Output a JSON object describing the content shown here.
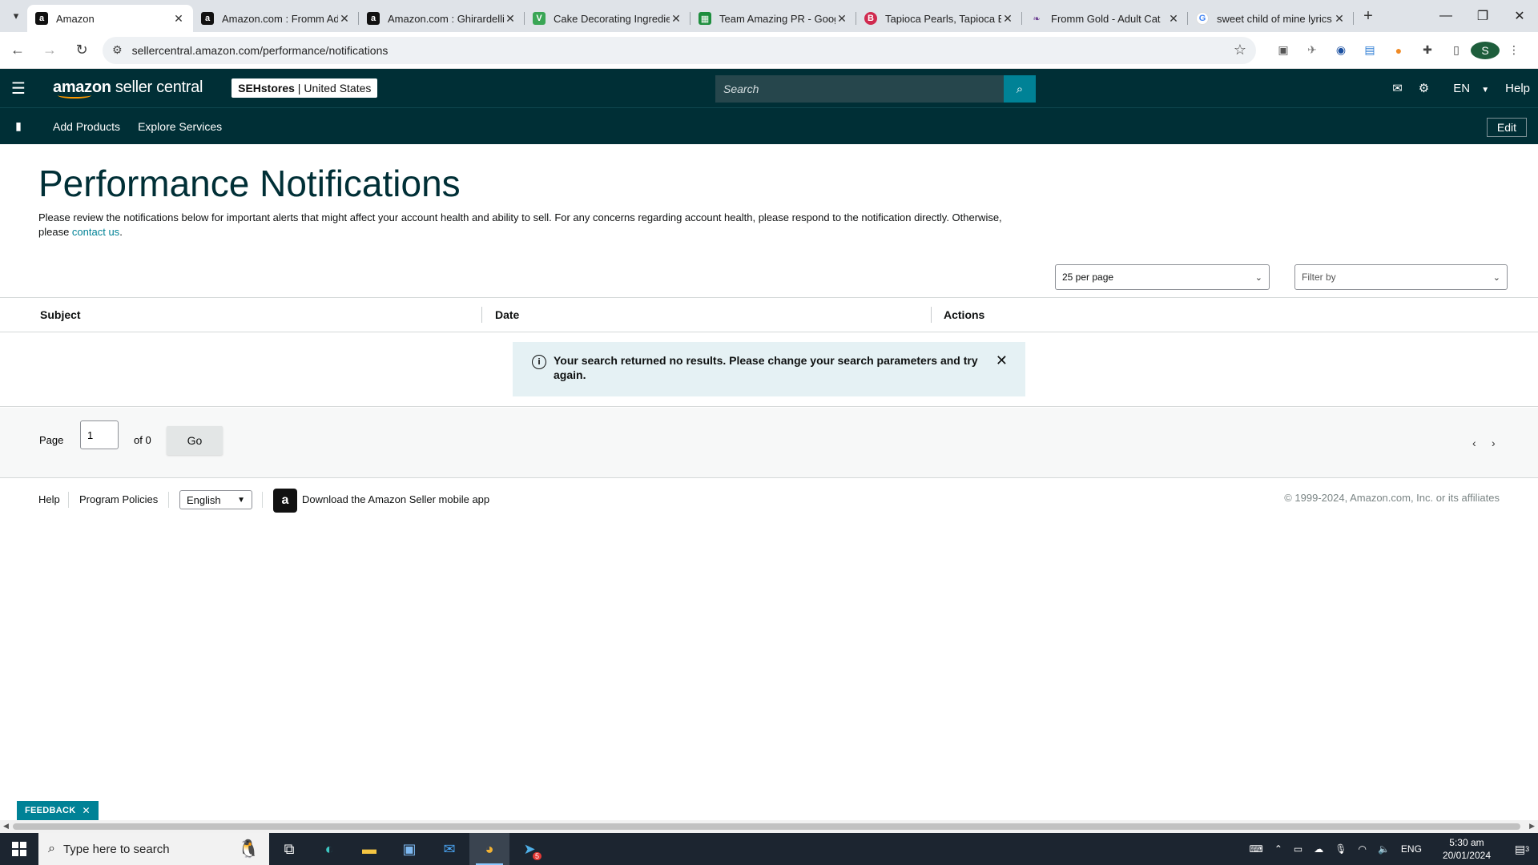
{
  "browser": {
    "tabs": [
      {
        "title": "Amazon",
        "favicon": "amazon-a",
        "active": true
      },
      {
        "title": "Amazon.com : Fromm Ad",
        "favicon": "amazon-a",
        "active": false
      },
      {
        "title": "Amazon.com : Ghirardelli",
        "favicon": "amazon-a",
        "active": false
      },
      {
        "title": "Cake Decorating Ingredie",
        "favicon": "leaf",
        "active": false
      },
      {
        "title": "Team Amazing PR - Goog",
        "favicon": "sheets",
        "active": false
      },
      {
        "title": "Tapioca Pearls, Tapioca Ba",
        "favicon": "b-red",
        "active": false
      },
      {
        "title": "Fromm Gold - Adult Cat",
        "favicon": "feather",
        "active": false
      },
      {
        "title": "sweet child of mine lyrics",
        "favicon": "google-g",
        "active": false
      }
    ],
    "url": "sellercentral.amazon.com/performance/notifications",
    "profile_initial": "S"
  },
  "header": {
    "logo_text_bold": "amazon",
    "logo_text": " seller central",
    "store_name": "SEHstores",
    "store_region": "United States",
    "search_placeholder": "Search",
    "language": "EN",
    "help": "Help"
  },
  "subnav": {
    "links": [
      "Add Products",
      "Explore Services"
    ],
    "edit": "Edit"
  },
  "page": {
    "title": "Performance Notifications",
    "description": "Please review the notifications below for important alerts that might affect your account health and ability to sell. For any concerns regarding account health, please respond to the notification directly. Otherwise, please ",
    "contact_link": "contact us",
    "description_end": ".",
    "per_page": "25 per page",
    "filter_placeholder": "Filter by"
  },
  "table": {
    "columns": [
      "Subject",
      "Date",
      "Actions"
    ],
    "empty_message": "Your search returned no results. Please change your search parameters and try again."
  },
  "pager": {
    "page_label": "Page",
    "page_value": "1",
    "of_label": "of 0",
    "go": "Go"
  },
  "footer": {
    "help": "Help",
    "policies": "Program Policies",
    "language": "English",
    "app_download": "Download the Amazon Seller mobile app",
    "copyright": "© 1999-2024, Amazon.com, Inc. or its affiliates"
  },
  "feedback": {
    "label": "FEEDBACK"
  },
  "taskbar": {
    "search_placeholder": "Type here to search",
    "lang": "ENG",
    "time": "5:30 am",
    "date": "20/01/2024",
    "telegram_badge": "5",
    "notif_count": "3"
  },
  "colors": {
    "header_bg": "#002f36",
    "accent_teal": "#008296",
    "alert_bg": "#e5f1f4",
    "title_color": "#002f36"
  }
}
